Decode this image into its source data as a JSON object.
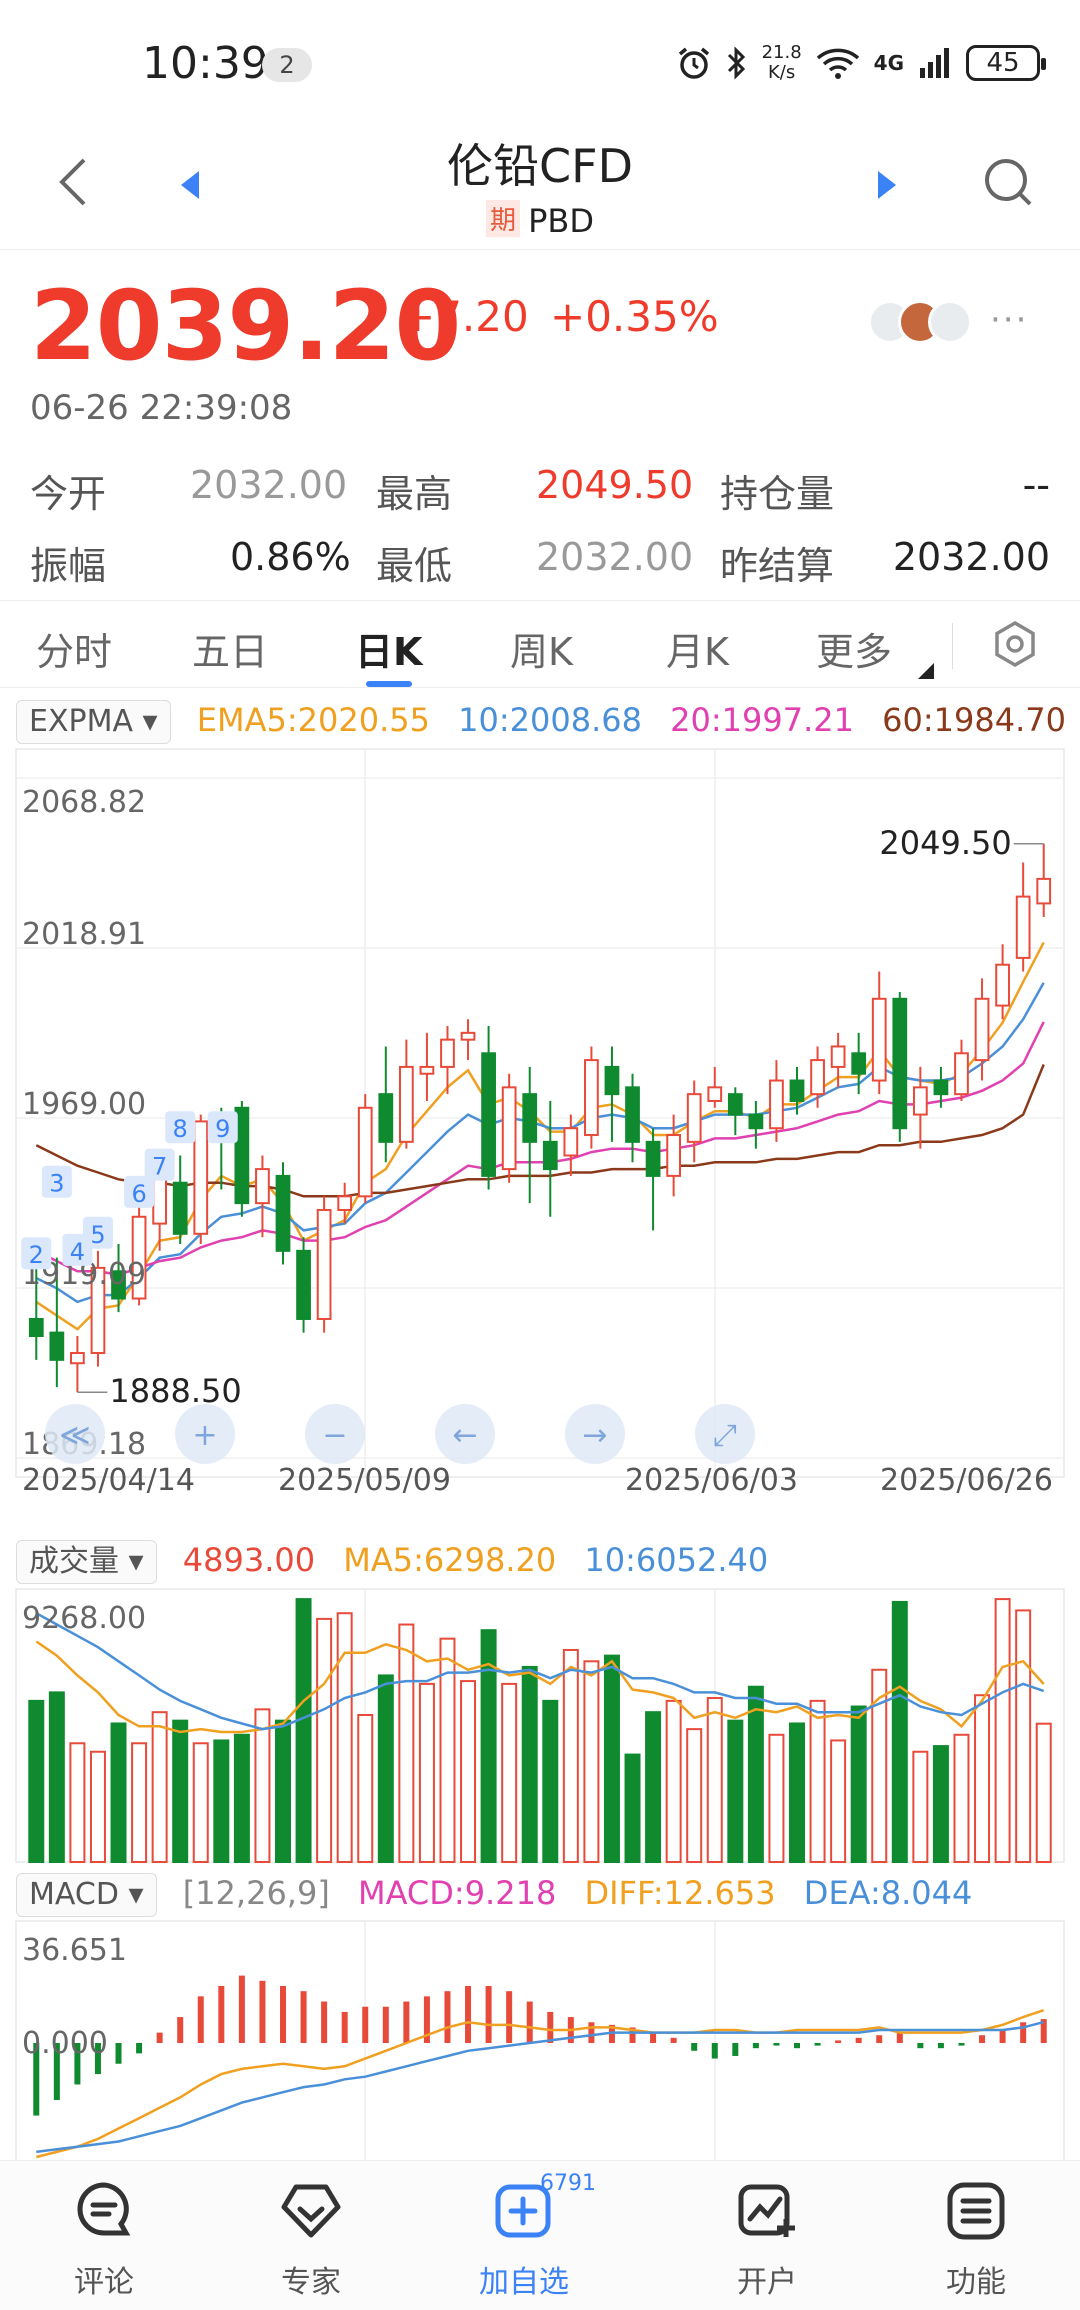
{
  "status": {
    "time": "10:39",
    "badge": "2",
    "speed_top": "21.8",
    "speed_unit": "K/s",
    "network": "4G",
    "battery": "45"
  },
  "header": {
    "title": "伦铅CFD",
    "tag": "期",
    "code": "PBD"
  },
  "quote": {
    "price": "2039.20",
    "change": "+7.20",
    "change_pct": "+0.35%",
    "time": "06-26 22:39:08",
    "more": "···"
  },
  "stats": {
    "open_label": "今开",
    "open_value": "2032.00",
    "high_label": "最高",
    "high_value": "2049.50",
    "oi_label": "持仓量",
    "oi_value": "--",
    "amp_label": "振幅",
    "amp_value": "0.86%",
    "low_label": "最低",
    "low_value": "2032.00",
    "settle_label": "昨结算",
    "settle_value": "2032.00"
  },
  "tabs": [
    {
      "label": "分时"
    },
    {
      "label": "五日"
    },
    {
      "label": "日K"
    },
    {
      "label": "周K"
    },
    {
      "label": "月K"
    },
    {
      "label": "更多"
    }
  ],
  "main_indicator": {
    "name": "EXPMA ▾",
    "ema5": "EMA5:2020.55",
    "ema10": "10:2008.68",
    "ema20": "20:1997.21",
    "ema60": "60:1984.70"
  },
  "volume_indicator": {
    "name": "成交量 ▾",
    "vol": "4893.00",
    "ma5": "MA5:6298.20",
    "ma10": "10:6052.40"
  },
  "macd_indicator": {
    "name": "MACD ▾",
    "params": "[12,26,9]",
    "macd": "MACD:9.218",
    "diff": "DIFF:12.653",
    "dea": "DEA:8.044"
  },
  "colors": {
    "up": "#e84a3a",
    "down": "#0f8a2e",
    "ema5": "#f0a020",
    "ema10": "#4a90d9",
    "ema20": "#e040b0",
    "ema60": "#8a3a1a",
    "accent": "#3b82f6"
  },
  "chart_data": [
    {
      "type": "candlestick",
      "y_ticks": [
        "2068.82",
        "2018.91",
        "1969.00",
        "1919.09",
        "1869.18"
      ],
      "ylim": [
        1869.18,
        2068.82
      ],
      "x_ticks": [
        "2025/04/14",
        "2025/05/09",
        "2025/06/03",
        "2025/06/26"
      ],
      "max_label": "2049.50",
      "min_label": "1888.50",
      "markers": [
        "2",
        "3",
        "4",
        "5",
        "6",
        "7",
        "8",
        "9"
      ],
      "candles": [
        {
          "o": 1910,
          "c": 1905,
          "h": 1932,
          "l": 1898
        },
        {
          "o": 1906,
          "c": 1898,
          "h": 1928,
          "l": 1890
        },
        {
          "o": 1897,
          "c": 1900,
          "h": 1905,
          "l": 1888.5
        },
        {
          "o": 1900,
          "c": 1925,
          "h": 1930,
          "l": 1896
        },
        {
          "o": 1924,
          "c": 1916,
          "h": 1932,
          "l": 1912
        },
        {
          "o": 1916,
          "c": 1940,
          "h": 1945,
          "l": 1914
        },
        {
          "o": 1938,
          "c": 1952,
          "h": 1956,
          "l": 1930
        },
        {
          "o": 1950,
          "c": 1935,
          "h": 1958,
          "l": 1932
        },
        {
          "o": 1935,
          "c": 1968,
          "h": 1970,
          "l": 1932
        },
        {
          "o": 1968,
          "c": 1966,
          "h": 1972,
          "l": 1948
        },
        {
          "o": 1972,
          "c": 1944,
          "h": 1974,
          "l": 1940
        },
        {
          "o": 1944,
          "c": 1954,
          "h": 1958,
          "l": 1934
        },
        {
          "o": 1952,
          "c": 1930,
          "h": 1956,
          "l": 1926
        },
        {
          "o": 1930,
          "c": 1910,
          "h": 1934,
          "l": 1906
        },
        {
          "o": 1910,
          "c": 1942,
          "h": 1946,
          "l": 1906
        },
        {
          "o": 1942,
          "c": 1946,
          "h": 1950,
          "l": 1938
        },
        {
          "o": 1946,
          "c": 1972,
          "h": 1976,
          "l": 1944
        },
        {
          "o": 1976,
          "c": 1962,
          "h": 1990,
          "l": 1956
        },
        {
          "o": 1962,
          "c": 1984,
          "h": 1992,
          "l": 1960
        },
        {
          "o": 1982,
          "c": 1984,
          "h": 1994,
          "l": 1974
        },
        {
          "o": 1984,
          "c": 1992,
          "h": 1996,
          "l": 1976
        },
        {
          "o": 1992,
          "c": 1994,
          "h": 1998,
          "l": 1986
        },
        {
          "o": 1988,
          "c": 1952,
          "h": 1996,
          "l": 1948
        },
        {
          "o": 1954,
          "c": 1978,
          "h": 1982,
          "l": 1950
        },
        {
          "o": 1976,
          "c": 1962,
          "h": 1984,
          "l": 1944
        },
        {
          "o": 1962,
          "c": 1954,
          "h": 1974,
          "l": 1940
        },
        {
          "o": 1958,
          "c": 1966,
          "h": 1970,
          "l": 1952
        },
        {
          "o": 1964,
          "c": 1986,
          "h": 1990,
          "l": 1960
        },
        {
          "o": 1984,
          "c": 1976,
          "h": 1990,
          "l": 1962
        },
        {
          "o": 1978,
          "c": 1962,
          "h": 1982,
          "l": 1956
        },
        {
          "o": 1962,
          "c": 1952,
          "h": 1966,
          "l": 1936
        },
        {
          "o": 1952,
          "c": 1964,
          "h": 1970,
          "l": 1946
        },
        {
          "o": 1962,
          "c": 1976,
          "h": 1980,
          "l": 1956
        },
        {
          "o": 1974,
          "c": 1978,
          "h": 1984,
          "l": 1972
        },
        {
          "o": 1976,
          "c": 1970,
          "h": 1978,
          "l": 1964
        },
        {
          "o": 1970,
          "c": 1966,
          "h": 1974,
          "l": 1960
        },
        {
          "o": 1966,
          "c": 1980,
          "h": 1986,
          "l": 1962
        },
        {
          "o": 1980,
          "c": 1974,
          "h": 1984,
          "l": 1970
        },
        {
          "o": 1976,
          "c": 1986,
          "h": 1990,
          "l": 1972
        },
        {
          "o": 1984,
          "c": 1990,
          "h": 1994,
          "l": 1978
        },
        {
          "o": 1988,
          "c": 1982,
          "h": 1994,
          "l": 1976
        },
        {
          "o": 1980,
          "c": 2004,
          "h": 2012,
          "l": 1976
        },
        {
          "o": 2004,
          "c": 1966,
          "h": 2006,
          "l": 1962
        },
        {
          "o": 1970,
          "c": 1978,
          "h": 1984,
          "l": 1960
        },
        {
          "o": 1980,
          "c": 1976,
          "h": 1984,
          "l": 1972
        },
        {
          "o": 1976,
          "c": 1988,
          "h": 1992,
          "l": 1974
        },
        {
          "o": 1986,
          "c": 2004,
          "h": 2010,
          "l": 1980
        },
        {
          "o": 2002,
          "c": 2014,
          "h": 2020,
          "l": 1998
        },
        {
          "o": 2016,
          "c": 2034,
          "h": 2044,
          "l": 2012
        },
        {
          "o": 2032,
          "c": 2039.2,
          "h": 2049.5,
          "l": 2028
        }
      ],
      "series": [
        {
          "name": "EMA5",
          "values": [
            1915,
            1911,
            1907,
            1913,
            1914,
            1923,
            1933,
            1934,
            1945,
            1952,
            1949,
            1951,
            1944,
            1933,
            1936,
            1939,
            1950,
            1954,
            1964,
            1971,
            1978,
            1983,
            1973,
            1975,
            1971,
            1965,
            1965,
            1972,
            1973,
            1970,
            1964,
            1964,
            1968,
            1971,
            1971,
            1969,
            1973,
            1973,
            1977,
            1981,
            1981,
            1989,
            1981,
            1980,
            1979,
            1982,
            1989,
            1997,
            2009,
            2020.55
          ]
        },
        {
          "name": "EMA10",
          "values": [
            1922,
            1919,
            1915,
            1917,
            1917,
            1922,
            1928,
            1929,
            1935,
            1940,
            1941,
            1943,
            1941,
            1936,
            1937,
            1938,
            1944,
            1947,
            1953,
            1959,
            1965,
            1970,
            1967,
            1969,
            1968,
            1966,
            1966,
            1969,
            1970,
            1969,
            1966,
            1966,
            1968,
            1970,
            1970,
            1970,
            1971,
            1972,
            1975,
            1978,
            1979,
            1984,
            1981,
            1980,
            1980,
            1981,
            1985,
            1990,
            1998,
            2008.68
          ]
        },
        {
          "name": "EMA20",
          "values": [
            1930,
            1927,
            1924,
            1924,
            1923,
            1925,
            1927,
            1928,
            1931,
            1933,
            1934,
            1936,
            1935,
            1933,
            1933,
            1934,
            1937,
            1939,
            1943,
            1947,
            1951,
            1955,
            1954,
            1956,
            1956,
            1956,
            1957,
            1959,
            1960,
            1960,
            1959,
            1960,
            1961,
            1963,
            1963,
            1964,
            1965,
            1966,
            1968,
            1970,
            1971,
            1974,
            1973,
            1973,
            1974,
            1975,
            1977,
            1980,
            1985,
            1997.21
          ]
        },
        {
          "name": "EMA60",
          "values": [
            1961,
            1958,
            1955,
            1953,
            1951,
            1950,
            1950,
            1949,
            1950,
            1950,
            1949,
            1949,
            1948,
            1946,
            1946,
            1946,
            1947,
            1947,
            1948,
            1949,
            1950,
            1951,
            1951,
            1952,
            1952,
            1952,
            1953,
            1953,
            1954,
            1954,
            1954,
            1955,
            1955,
            1956,
            1956,
            1956,
            1957,
            1957,
            1958,
            1959,
            1959,
            1961,
            1961,
            1962,
            1962,
            1963,
            1964,
            1966,
            1970,
            1984.7
          ]
        }
      ]
    },
    {
      "type": "bar",
      "y_ticks": [
        "9268.00"
      ],
      "ylim": [
        0,
        9268
      ],
      "values": [
        5700,
        6000,
        4200,
        3900,
        4900,
        4200,
        5300,
        5000,
        4200,
        4300,
        4500,
        5400,
        5000,
        9300,
        8600,
        8800,
        5200,
        6600,
        8400,
        6300,
        7900,
        6400,
        8200,
        6300,
        6900,
        5700,
        7500,
        7100,
        7300,
        3800,
        5300,
        5700,
        4700,
        5800,
        5000,
        6200,
        4500,
        4900,
        5700,
        4300,
        5500,
        6800,
        9200,
        3900,
        4100,
        4500,
        5900,
        9300,
        8900,
        4893
      ],
      "series": [
        {
          "name": "MA5",
          "values": [
            7800,
            7300,
            6600,
            6000,
            5200,
            4800,
            4800,
            4600,
            4700,
            4600,
            4600,
            4700,
            4900,
            5700,
            6300,
            7400,
            7400,
            7700,
            7500,
            7100,
            7200,
            6800,
            7000,
            6600,
            6700,
            6300,
            6900,
            6600,
            7100,
            6100,
            6000,
            5800,
            5100,
            5300,
            5100,
            5400,
            5300,
            5500,
            5100,
            5200,
            5100,
            5800,
            6200,
            5700,
            5400,
            4800,
            5700,
            6900,
            7100,
            6298.2
          ]
        },
        {
          "name": "MA10",
          "values": [
            8800,
            8400,
            8000,
            7600,
            7100,
            6600,
            6100,
            5700,
            5400,
            5100,
            4900,
            4700,
            4800,
            5100,
            5400,
            5800,
            6000,
            6300,
            6400,
            6400,
            6700,
            6700,
            6800,
            6700,
            6800,
            6500,
            6800,
            6700,
            6900,
            6500,
            6500,
            6300,
            6000,
            6000,
            5800,
            5800,
            5600,
            5600,
            5300,
            5300,
            5300,
            5600,
            5900,
            5500,
            5300,
            5200,
            5600,
            6000,
            6300,
            6052.4
          ]
        }
      ]
    },
    {
      "type": "bar",
      "y_ticks": [
        "36.651",
        "0.000"
      ],
      "ylim": [
        -36.651,
        36.651
      ],
      "values": [
        -28,
        -22,
        -16,
        -12,
        -8,
        -4,
        4,
        10,
        18,
        22,
        26,
        24,
        22,
        20,
        16,
        12,
        14,
        14,
        16,
        18,
        20,
        22,
        22,
        20,
        16,
        12,
        10,
        8,
        7,
        6,
        4,
        2,
        -3,
        -6,
        -5,
        -2,
        -1,
        -2,
        -1,
        1,
        2,
        3,
        4,
        -2,
        -2,
        -1,
        3,
        5,
        8,
        9.218
      ],
      "series": [
        {
          "name": "DIFF",
          "values": [
            -44,
            -42,
            -40,
            -37,
            -33,
            -29,
            -25,
            -21,
            -16,
            -12,
            -10,
            -9,
            -8,
            -9,
            -10,
            -9,
            -6,
            -3,
            0,
            3,
            6,
            8,
            7,
            7,
            6,
            5,
            5,
            6,
            6,
            5,
            4,
            4,
            4,
            5,
            5,
            4,
            4,
            5,
            5,
            5,
            5,
            6,
            4,
            4,
            4,
            4,
            5,
            7,
            10,
            12.653
          ]
        },
        {
          "name": "DEA",
          "values": [
            -42,
            -41,
            -40,
            -39,
            -38,
            -36,
            -34,
            -32,
            -29,
            -26,
            -23,
            -21,
            -19,
            -17,
            -16,
            -14,
            -13,
            -11,
            -9,
            -7,
            -5,
            -3,
            -2,
            -1,
            0,
            1,
            2,
            3,
            4,
            4,
            4,
            4,
            4,
            4,
            4,
            4,
            4,
            4,
            4,
            4,
            4,
            5,
            5,
            5,
            5,
            5,
            5,
            5,
            6,
            8.044
          ]
        }
      ]
    }
  ],
  "chart_controls": {
    "labels": [
      "≪",
      "+",
      "−",
      "←",
      "→",
      "⤢"
    ]
  },
  "nav": [
    {
      "label": "评论"
    },
    {
      "label": "专家"
    },
    {
      "label": "加自选",
      "count": "6791"
    },
    {
      "label": "开户"
    },
    {
      "label": "功能"
    }
  ]
}
